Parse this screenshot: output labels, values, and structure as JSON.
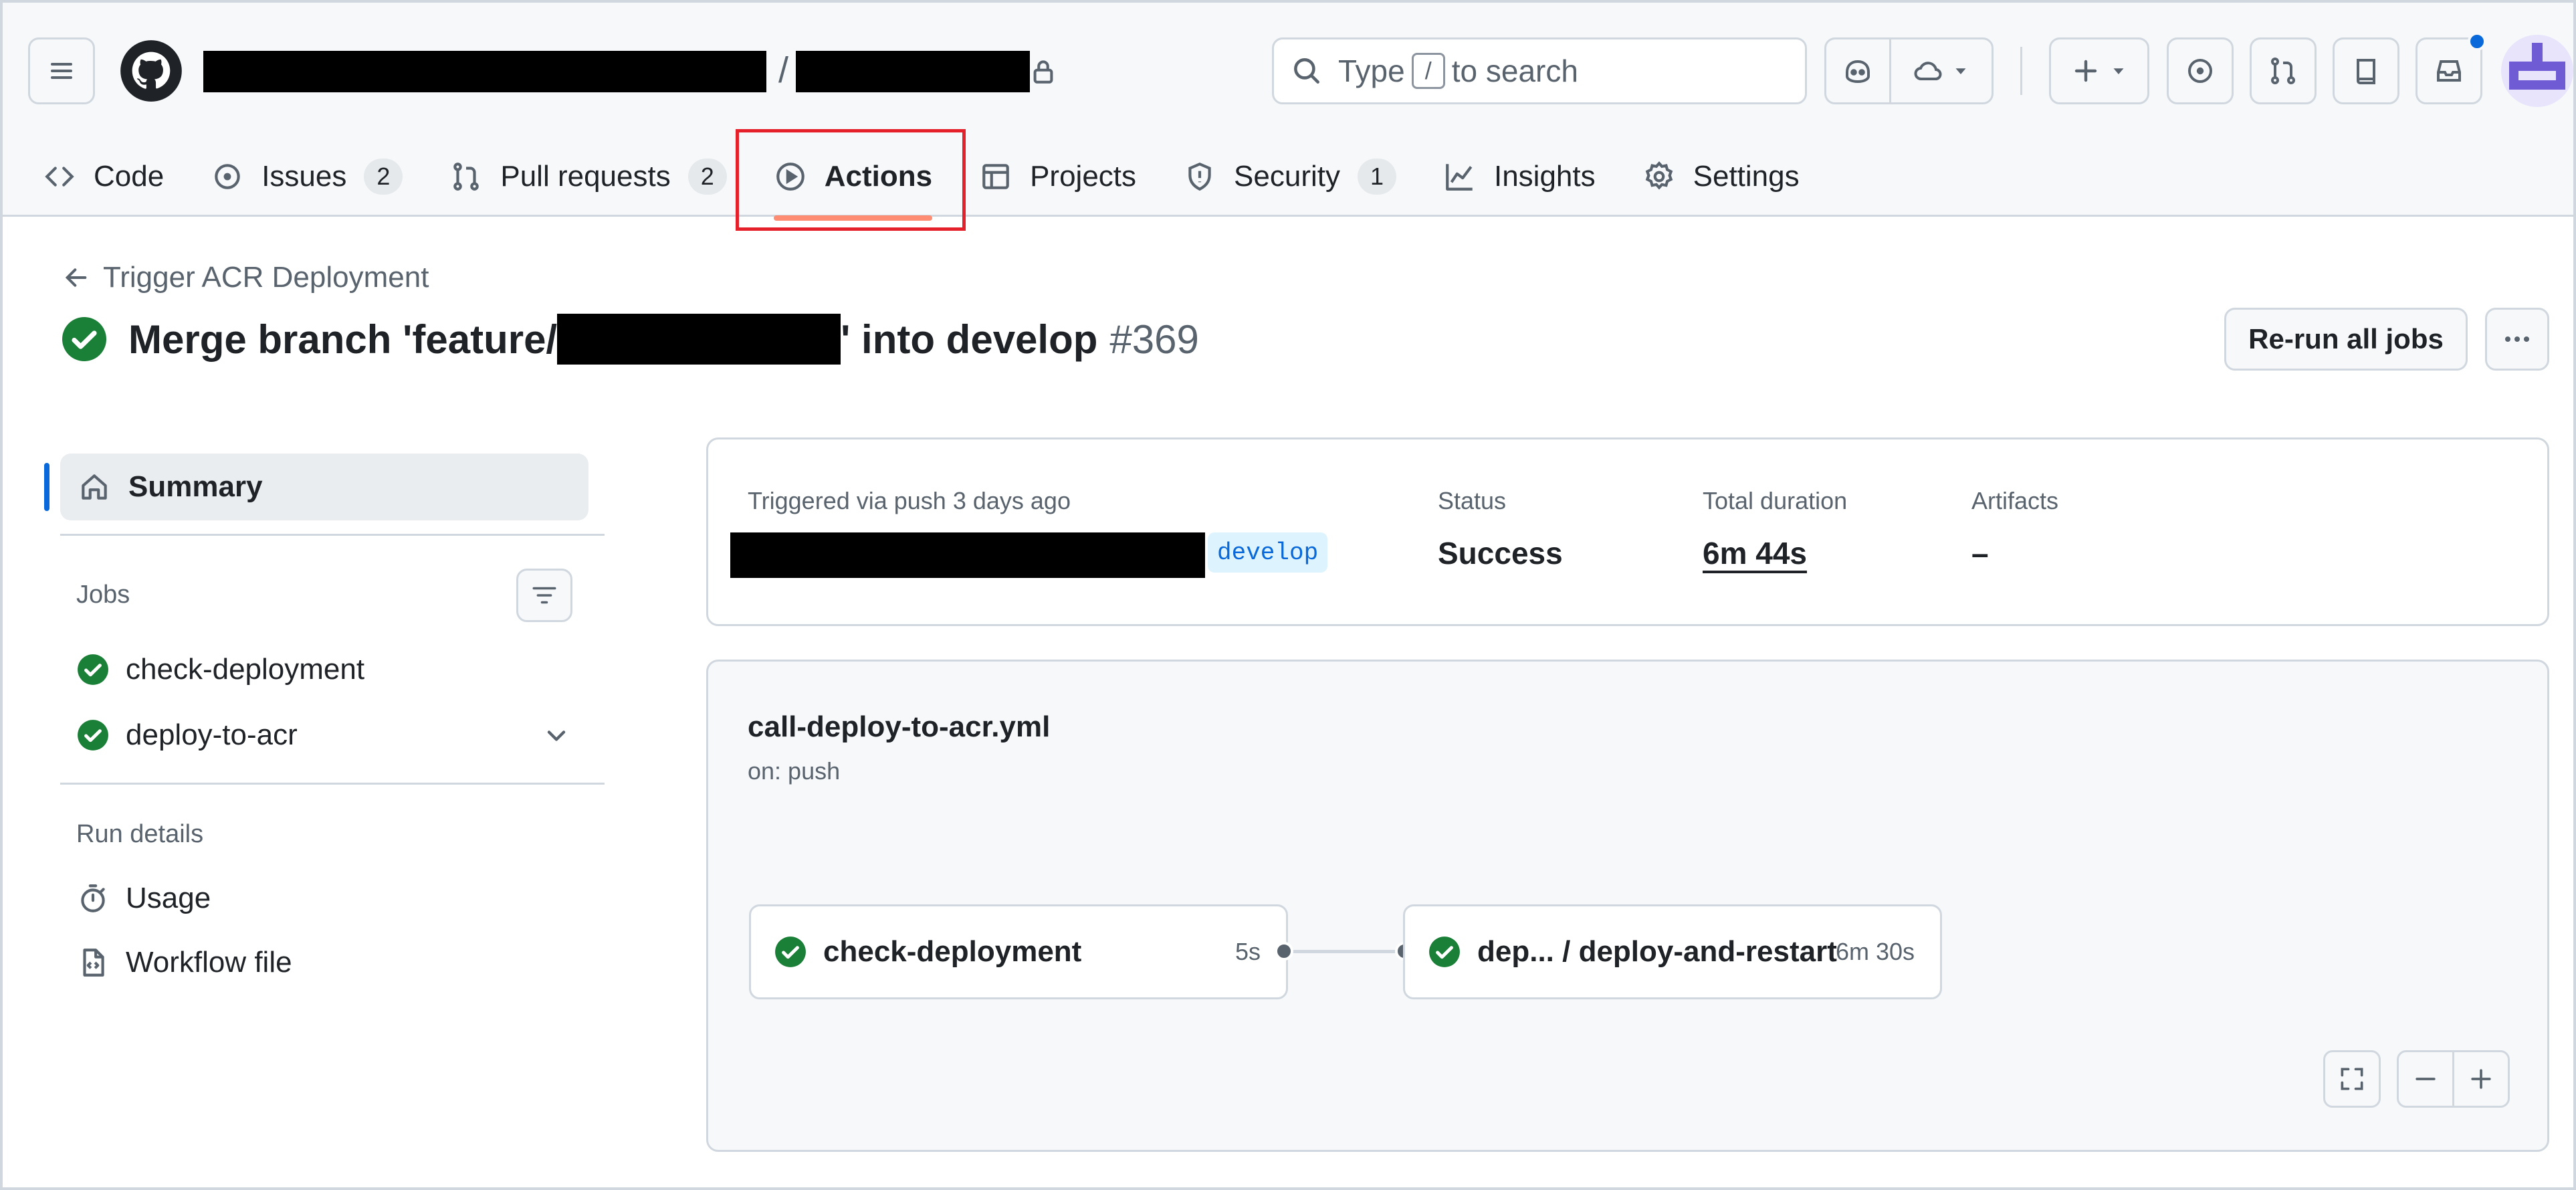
{
  "search": {
    "before": "Type",
    "key": "/",
    "after": "to search"
  },
  "tabs": [
    {
      "label": "Code",
      "count": ""
    },
    {
      "label": "Issues",
      "count": "2"
    },
    {
      "label": "Pull requests",
      "count": "2"
    },
    {
      "label": "Actions",
      "count": ""
    },
    {
      "label": "Projects",
      "count": ""
    },
    {
      "label": "Security",
      "count": "1"
    },
    {
      "label": "Insights",
      "count": ""
    },
    {
      "label": "Settings",
      "count": ""
    }
  ],
  "workflow": {
    "back_label": "Trigger ACR Deployment",
    "title_prefix": "Merge branch 'feature/",
    "title_suffix": "' into develop",
    "run_number": "#369",
    "rerun_label": "Re-run all jobs"
  },
  "sidebar": {
    "summary_label": "Summary",
    "jobs_heading": "Jobs",
    "jobs": [
      {
        "name": "check-deployment",
        "status": "success"
      },
      {
        "name": "deploy-to-acr",
        "status": "success"
      }
    ],
    "run_details_heading": "Run details",
    "usage_label": "Usage",
    "workflow_file_label": "Workflow file"
  },
  "summary": {
    "trigger_text": "Triggered via push 3 days ago",
    "branch": "develop",
    "status_label": "Status",
    "status_value": "Success",
    "duration_label": "Total duration",
    "duration_value": "6m 44s",
    "artifacts_label": "Artifacts",
    "artifacts_value": "–"
  },
  "graph": {
    "file_name": "call-deploy-to-acr.yml",
    "trigger": "on: push",
    "jobs": [
      {
        "name": "check-deployment",
        "duration": "5s"
      },
      {
        "name": "dep... / deploy-and-restart",
        "duration": "6m 30s"
      }
    ]
  },
  "colors": {
    "success": "#1a7f37",
    "accent": "#0969da",
    "active_tab_underline": "#fd8c73",
    "highlight_box": "#e5202a"
  }
}
